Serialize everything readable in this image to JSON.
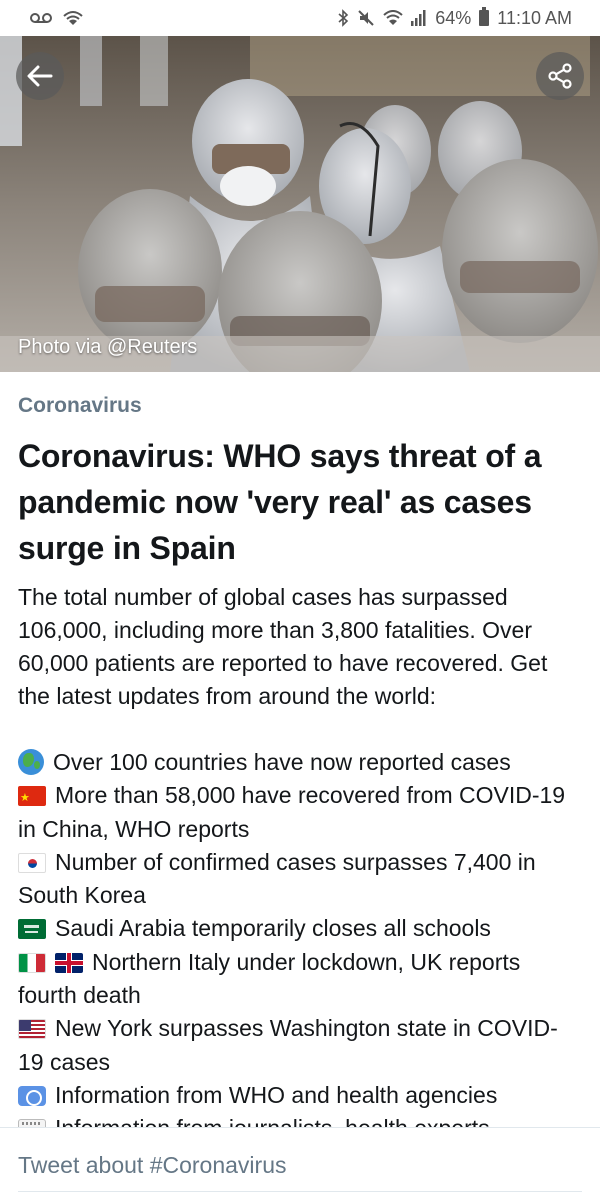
{
  "status_bar": {
    "battery_percent": "64%",
    "time": "11:10 AM",
    "icons": [
      "voicemail-icon",
      "wifi-hotspot-icon",
      "bluetooth-icon",
      "mute-icon",
      "wifi-icon",
      "signal-icon",
      "battery-icon"
    ]
  },
  "hero": {
    "photo_credit": "Photo via @Reuters",
    "back_icon": "arrow-left-icon",
    "share_icon": "share-icon"
  },
  "article": {
    "topic": "Coronavirus",
    "headline": "Coronavirus: WHO says threat of a pandemic now 'very real' as cases surge in Spain",
    "summary": "The total number of global cases has surpassed 106,000, including more than 3,800 fatalities. Over 60,000 patients are reported to have recovered. Get the latest updates from around the world:",
    "bullets": [
      {
        "icons": [
          "globe-emoji"
        ],
        "text": "Over 100 countries have now reported cases"
      },
      {
        "icons": [
          "china-flag"
        ],
        "text": "More than 58,000 have recovered from COVID-19 in China, WHO reports"
      },
      {
        "icons": [
          "south-korea-flag"
        ],
        "text": "Number of confirmed cases surpasses 7,400 in South Korea"
      },
      {
        "icons": [
          "saudi-arabia-flag"
        ],
        "text": "Saudi Arabia temporarily closes all schools"
      },
      {
        "icons": [
          "italy-flag",
          "uk-flag"
        ],
        "text": "Northern Italy under lockdown, UK reports fourth death"
      },
      {
        "icons": [
          "usa-flag"
        ],
        "text": "New York surpasses Washington state in COVID-19 cases"
      },
      {
        "icons": [
          "united-nations-flag"
        ],
        "text": "Information from WHO and health agencies"
      },
      {
        "icons": [
          "notepad-emoji"
        ],
        "text": "Information from journalists, health experts"
      }
    ]
  },
  "footer": {
    "tweet_about": "Tweet about #Coronavirus"
  },
  "colors": {
    "topic": "#657786",
    "text": "#14171a",
    "muted": "#657786"
  }
}
